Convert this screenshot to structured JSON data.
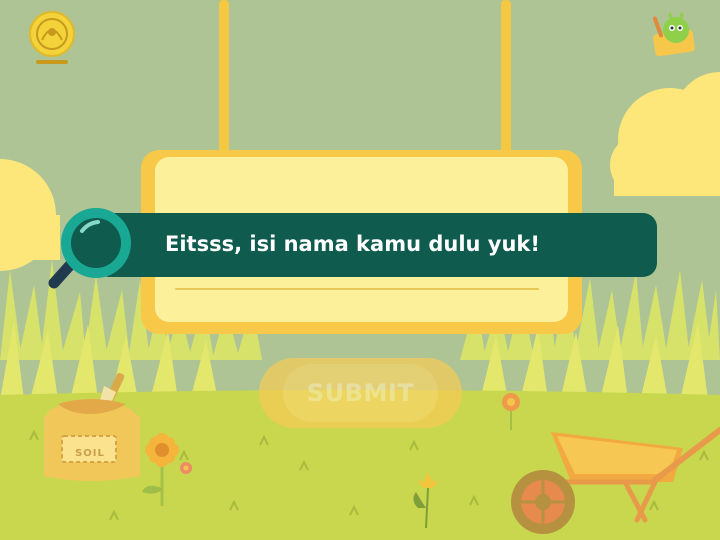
{
  "prompt": {
    "message": "Eitsss, isi nama kamu dulu yuk!"
  },
  "form": {
    "name_value": "",
    "submit_label": "SUBMIT"
  },
  "decor": {
    "soil_bag_label": "SOIL"
  },
  "icons": {
    "logo": "institution-emblem-icon",
    "mascot": "mascot-icon",
    "magnifier": "magnifying-glass-icon"
  },
  "colors": {
    "sky": "#aec494",
    "board": "#f8c848",
    "board_inner": "#fdf09a",
    "banner": "#0f5b4e",
    "grass": "#c8d74d",
    "button": "#f6cb56"
  }
}
